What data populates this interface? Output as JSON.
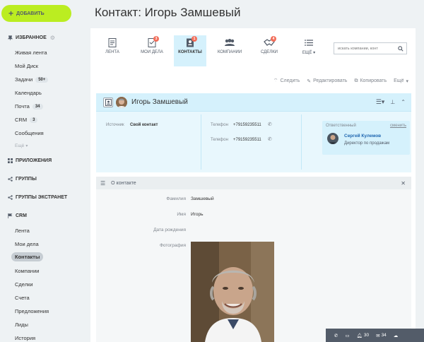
{
  "sidebar": {
    "add_label": "ДОБАВИТЬ",
    "sections": {
      "favorites": "ИЗБРАННОЕ",
      "apps": "ПРИЛОЖЕНИЯ",
      "groups": "ГРУППЫ",
      "extranet": "ГРУППЫ ЭКСТРАНЕТ",
      "crm": "CRM"
    },
    "favorites_items": [
      {
        "label": "Живая лента"
      },
      {
        "label": "Мой Диск"
      },
      {
        "label": "Задачи",
        "badge": "50+"
      },
      {
        "label": "Календарь"
      },
      {
        "label": "Почта",
        "badge": "34"
      },
      {
        "label": "CRM",
        "badge": "3"
      },
      {
        "label": "Сообщения"
      },
      {
        "label": "Ещё"
      }
    ],
    "crm_items": [
      {
        "label": "Лента"
      },
      {
        "label": "Мои дела"
      },
      {
        "label": "Контакты"
      },
      {
        "label": "Компании"
      },
      {
        "label": "Сделки"
      },
      {
        "label": "Счета"
      },
      {
        "label": "Предложения"
      },
      {
        "label": "Лиды"
      },
      {
        "label": "История"
      }
    ]
  },
  "page": {
    "title": "Контакт: Игорь Замшевый"
  },
  "tabs": [
    {
      "label": "ЛЕНТА"
    },
    {
      "label": "МОИ ДЕЛА",
      "count": "3"
    },
    {
      "label": "КОНТАКТЫ",
      "count": "1"
    },
    {
      "label": "КОМПАНИИ"
    },
    {
      "label": "СДЕЛКИ",
      "count": "4"
    },
    {
      "label": "ЕЩЁ"
    }
  ],
  "search": {
    "placeholder": "искать компании, конт"
  },
  "actions": {
    "follow": "Следить",
    "edit": "Редактировать",
    "copy": "Копировать",
    "more": "Ещё"
  },
  "contact": {
    "name": "Игорь Замшевый",
    "source_label": "Источник",
    "source_value": "Свой контакт",
    "phones": [
      {
        "label": "Телефон",
        "value": "+79159235511"
      },
      {
        "label": "Телефон",
        "value": "+79159235511"
      }
    ],
    "responsible_label": "Ответственный",
    "change_label": "сменить",
    "responsible_name": "Сергей Кулемов",
    "responsible_position": "Директор по продажам"
  },
  "about": {
    "header": "О контакте",
    "fields": [
      {
        "label": "Фамилия",
        "value": "Замшевый"
      },
      {
        "label": "Имя",
        "value": "Игорь"
      },
      {
        "label": "Дата рождения",
        "value": ""
      },
      {
        "label": "Фотография",
        "value": ""
      }
    ]
  },
  "statusbar": {
    "notifications": "30",
    "mail": "34"
  },
  "colors": {
    "accent_green": "#bbed21",
    "active_tab": "#d5f1fc",
    "counter_red": "#f26e5a",
    "link_blue": "#2067b0"
  }
}
